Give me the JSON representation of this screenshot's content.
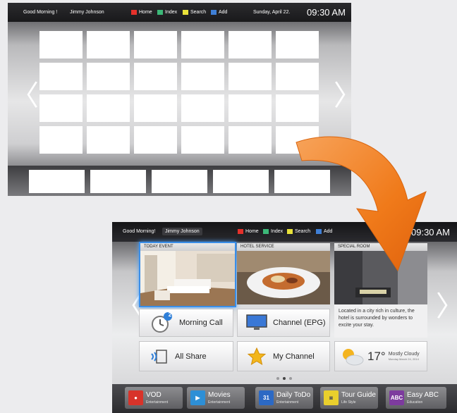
{
  "wireframe": {
    "greeting": "Good Morning !",
    "user": "Jimmy Johnson",
    "legend": [
      {
        "label": "Home",
        "color": "#e5312b"
      },
      {
        "label": "Index",
        "color": "#3cb878"
      },
      {
        "label": "Search",
        "color": "#e9e23a"
      },
      {
        "label": "Add",
        "color": "#3f7fd6"
      }
    ],
    "date": "Sunday, April 22.",
    "time": "09:30 AM"
  },
  "tv": {
    "greeting": "Good Morning!",
    "user": "Jimmy Johnson",
    "legend": [
      {
        "label": "Home",
        "color": "#e5312b"
      },
      {
        "label": "Index",
        "color": "#3cb878"
      },
      {
        "label": "Search",
        "color": "#e9e23a"
      },
      {
        "label": "Add",
        "color": "#3f7fd6"
      }
    ],
    "time": "09:30 AM",
    "cards": {
      "today_event": "TODAY EVENT",
      "hotel_service": "HOTEL SERVICE",
      "special": "SPECIAL ROOM",
      "special_text": "Located in a city rich in culture, the hotel is surrounded by wonders to excite your stay."
    },
    "buttons": {
      "morning_call": "Morning Call",
      "morning_call_badge": "2",
      "channel": "Channel (EPG)",
      "all_share": "All Share",
      "my_channel": "My Channel"
    },
    "weather": {
      "temp": "17°",
      "condition": "Mostly Cloudy",
      "date": "Monday March 24, 2014"
    },
    "apps": [
      {
        "name": "VOD",
        "category": "Entertainment",
        "color": "#d8332a"
      },
      {
        "name": "Movies",
        "category": "Entertainment",
        "color": "#2d8fd6"
      },
      {
        "name": "Daily ToDo",
        "category": "Entertainment",
        "color": "#2c69c4"
      },
      {
        "name": "Tour Guide",
        "category": "Life Style",
        "color": "#e9cf2d"
      },
      {
        "name": "Easy ABC",
        "category": "Education",
        "color": "#7d3b9e"
      }
    ]
  }
}
